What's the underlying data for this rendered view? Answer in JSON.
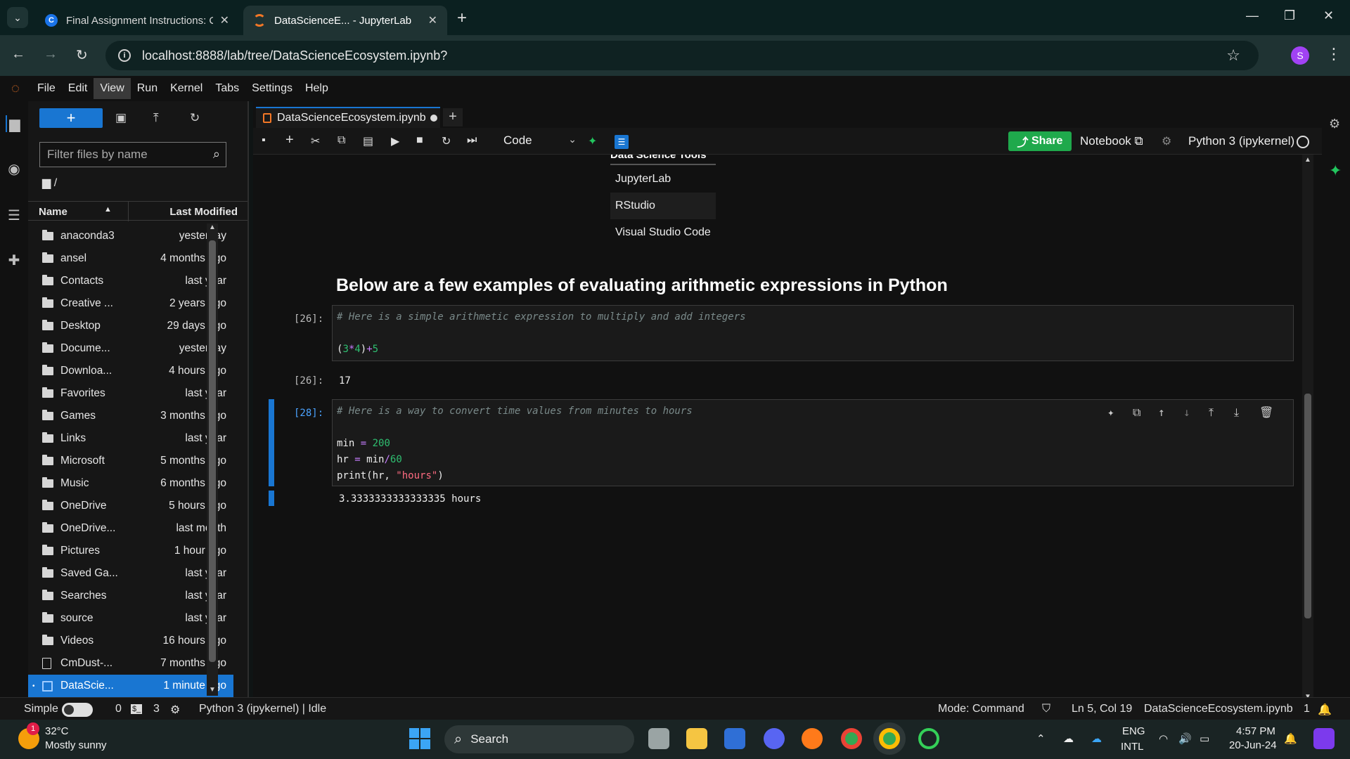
{
  "browser": {
    "tabs": [
      {
        "title": "Final Assignment Instructions: C"
      },
      {
        "title": "DataScienceE... - JupyterLab"
      }
    ],
    "url": "localhost:8888/lab/tree/DataScienceEcosystem.ipynb?",
    "profile_initial": "S"
  },
  "menubar": [
    "File",
    "Edit",
    "View",
    "Run",
    "Kernel",
    "Tabs",
    "Settings",
    "Help"
  ],
  "filebrowser": {
    "filter_placeholder": "Filter files by name",
    "path": "/",
    "col_name": "Name",
    "col_modified": "Last Modified",
    "items": [
      {
        "name": "anaconda3",
        "modified": "yesterday",
        "type": "folder"
      },
      {
        "name": "ansel",
        "modified": "4 months ago",
        "type": "folder"
      },
      {
        "name": "Contacts",
        "modified": "last year",
        "type": "folder"
      },
      {
        "name": "Creative ...",
        "modified": "2 years ago",
        "type": "folder"
      },
      {
        "name": "Desktop",
        "modified": "29 days ago",
        "type": "folder"
      },
      {
        "name": "Docume...",
        "modified": "yesterday",
        "type": "folder"
      },
      {
        "name": "Downloa...",
        "modified": "4 hours ago",
        "type": "folder"
      },
      {
        "name": "Favorites",
        "modified": "last year",
        "type": "folder"
      },
      {
        "name": "Games",
        "modified": "3 months ago",
        "type": "folder"
      },
      {
        "name": "Links",
        "modified": "last year",
        "type": "folder"
      },
      {
        "name": "Microsoft",
        "modified": "5 months ago",
        "type": "folder"
      },
      {
        "name": "Music",
        "modified": "6 months ago",
        "type": "folder"
      },
      {
        "name": "OneDrive",
        "modified": "5 hours ago",
        "type": "folder"
      },
      {
        "name": "OneDrive...",
        "modified": "last month",
        "type": "folder"
      },
      {
        "name": "Pictures",
        "modified": "1 hour ago",
        "type": "folder"
      },
      {
        "name": "Saved Ga...",
        "modified": "last year",
        "type": "folder"
      },
      {
        "name": "Searches",
        "modified": "last year",
        "type": "folder"
      },
      {
        "name": "source",
        "modified": "last year",
        "type": "folder"
      },
      {
        "name": "Videos",
        "modified": "16 hours ago",
        "type": "folder"
      },
      {
        "name": "CmDust-...",
        "modified": "7 months ago",
        "type": "doc"
      },
      {
        "name": "DataScie...",
        "modified": "1 minute ago",
        "type": "notebook",
        "selected": true
      }
    ]
  },
  "notebook": {
    "tab_title": "DataScienceEcosystem.ipynb",
    "cell_type": "Code",
    "share_label": "Share",
    "notebook_label": "Notebook",
    "kernel_label": "Python 3 (ipykernel)",
    "table_header": "Data Science Tools",
    "table_rows": [
      "JupyterLab",
      "RStudio",
      "Visual Studio Code"
    ],
    "heading": "Below are a few examples of evaluating arithmetic expressions in Python",
    "cells": [
      {
        "prompt": "[26]:",
        "comment": "# Here is a simple arithmetic expression to multiply and add integers",
        "output_prompt": "[26]:",
        "output": "17"
      },
      {
        "prompt": "[28]:",
        "comment": "# Here is a way to convert time values from minutes to hours",
        "output": "3.3333333333333335 hours"
      }
    ]
  },
  "statusbar": {
    "simple": "Simple",
    "count_a": "0",
    "count_b": "3",
    "kernel_status": "Python 3 (ipykernel) | Idle",
    "mode": "Mode: Command",
    "position": "Ln 5, Col 19",
    "filename": "DataScienceEcosystem.ipynb",
    "notifications": "1"
  },
  "taskbar": {
    "temperature": "32°C",
    "weather": "Mostly sunny",
    "weather_badge": "1",
    "search_label": "Search",
    "lang1": "ENG",
    "lang2": "INTL",
    "time": "4:57 PM",
    "date": "20-Jun-24"
  }
}
